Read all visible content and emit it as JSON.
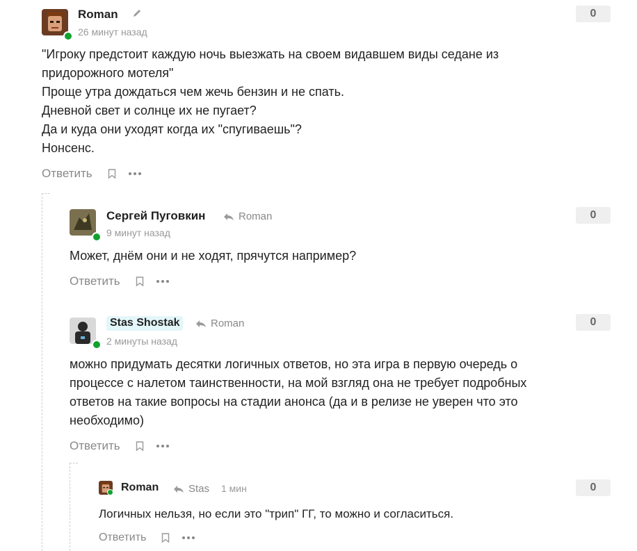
{
  "comments": [
    {
      "author": "Roman",
      "time": "26 минут назад",
      "rating": "0",
      "text_lines": [
        "\"Игроку предстоит каждую ночь выезжать на своем видавшем виды седане из",
        "придорожного мотеля\"",
        "Проще утра дождаться чем жечь бензин и не спать.",
        "Дневной свет и солнце их не пугает?",
        "Да и куда они уходят когда их \"спугиваешь\"?",
        "Нонсенс."
      ],
      "reply_label": "Ответить",
      "avatar_colors": {
        "bg": "#6b3b22",
        "face": "#d9a07a",
        "hair": "#7a3b12"
      }
    },
    {
      "author": "Сергей Пуговкин",
      "reply_to": "Roman",
      "time": "9 минут назад",
      "rating": "0",
      "text_lines": [
        "Может, днём они и не ходят, прячутся например?"
      ],
      "reply_label": "Ответить",
      "avatar_colors": {
        "bg": "#7a7050",
        "face": "#3e3a22"
      }
    },
    {
      "author": "Stas Shostak",
      "reply_to": "Roman",
      "time": "2 минуты назад",
      "rating": "0",
      "text_lines": [
        "можно придумать десятки логичных ответов, но эта игра в первую очередь о",
        "процессе с налетом таинственности, на мой взгляд она не требует подробных",
        "ответов на такие вопросы на стадии анонса (да и в релизе не уверен что это",
        "необходимо)"
      ],
      "reply_label": "Ответить",
      "avatar_colors": {
        "bg": "#d9d9d9",
        "face": "#2a2a2a"
      }
    },
    {
      "author": "Roman",
      "reply_to": "Stas",
      "time": "1 мин",
      "rating": "0",
      "text_lines": [
        "Логичных нельзя, но если это \"трип\" ГГ, то можно и согласиться."
      ],
      "reply_label": "Ответить",
      "avatar_colors": {
        "bg": "#6b3b22",
        "face": "#d9a07a",
        "hair": "#7a3b12"
      }
    }
  ],
  "icons": {
    "edit": "pencil-icon",
    "reply_arrow": "reply-arrow-icon",
    "bookmark": "bookmark-icon",
    "more": "more-icon"
  },
  "colors": {
    "online": "#12a22f",
    "author_highlight": "#e3f6fa",
    "rating_bg": "#efefef"
  }
}
